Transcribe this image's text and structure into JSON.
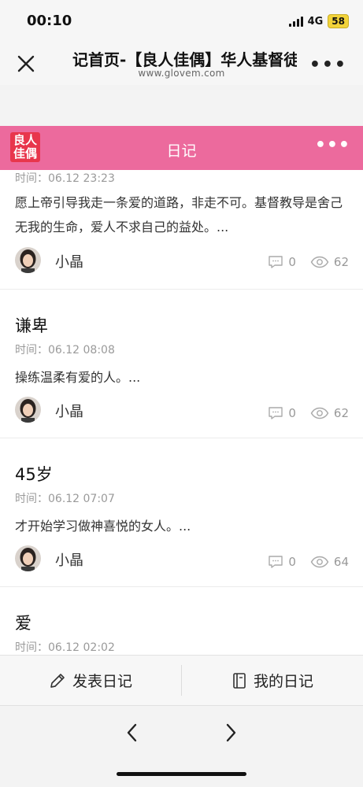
{
  "status": {
    "time": "00:10",
    "network": "4G",
    "battery": "58"
  },
  "browser": {
    "title": "记首页-【良人佳偶】华人基督徒婚恋",
    "url": "www.glovem.com"
  },
  "app": {
    "logo_text": "良人佳偶",
    "title": "日记",
    "more": "•••"
  },
  "entries": [
    {
      "title": "",
      "time": "时间：06.12 23:23",
      "excerpt": "愿上帝引导我走一条爱的道路，非走不可。基督教导是舍己无我的生命，爱人不求自己的益处。...",
      "author": "小晶",
      "comments": "0",
      "views": "62"
    },
    {
      "title": "谦卑",
      "time": "时间：06.12 08:08",
      "excerpt": "操练温柔有爱的人。...",
      "author": "小晶",
      "comments": "0",
      "views": "62"
    },
    {
      "title": "45岁",
      "time": "时间：06.12 07:07",
      "excerpt": "才开始学习做神喜悦的女人。...",
      "author": "小晶",
      "comments": "0",
      "views": "64"
    },
    {
      "title": "爱",
      "time": "时间：06.12 02:02",
      "excerpt": "",
      "author": "",
      "comments": "",
      "views": ""
    }
  ],
  "actions": {
    "publish": "发表日记",
    "mine": "我的日记"
  },
  "colors": {
    "brand_pink": "#ec6a9d",
    "logo_red": "#e8364c"
  }
}
